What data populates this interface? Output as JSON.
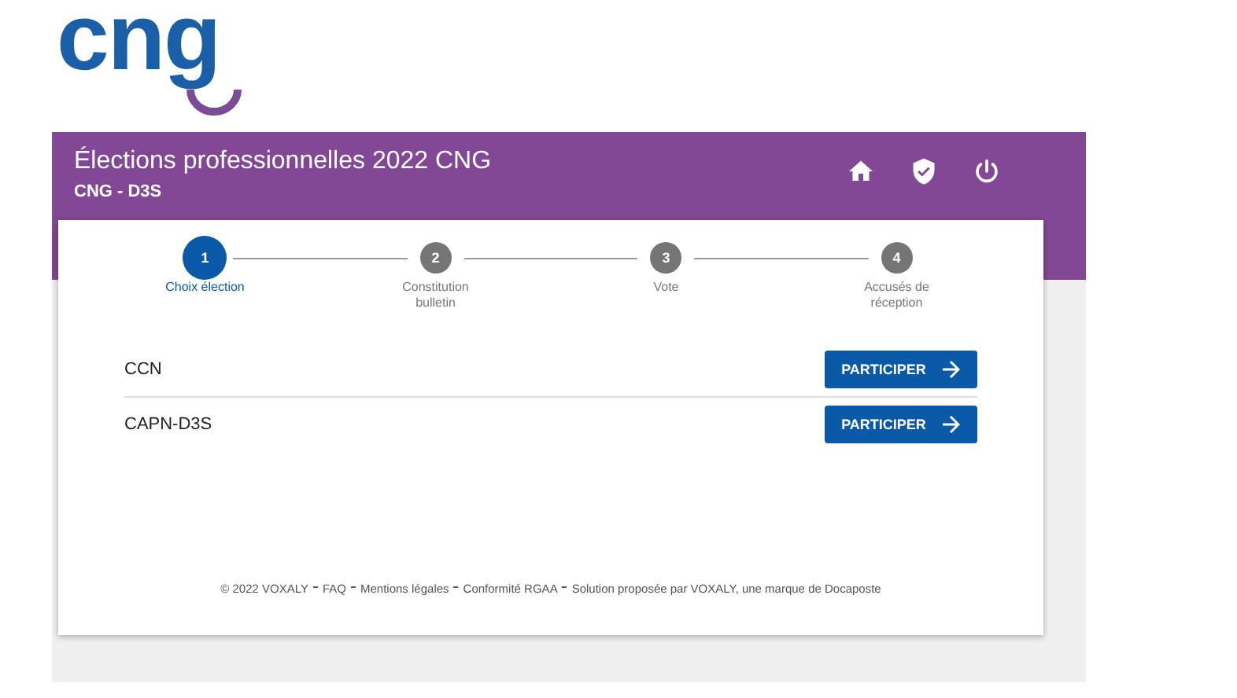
{
  "logo": {
    "text": "cng"
  },
  "header": {
    "title": "Élections professionnelles 2022 CNG",
    "subtitle": "CNG - D3S"
  },
  "toolbar": [
    {
      "kind": "home"
    },
    {
      "kind": "shield"
    },
    {
      "kind": "power"
    }
  ],
  "steps": [
    {
      "number": "1",
      "label": "Choix élection",
      "selected": true
    },
    {
      "number": "2",
      "label": "Constitution bulletin",
      "selected": false
    },
    {
      "number": "3",
      "label": "Vote",
      "selected": false
    },
    {
      "number": "4",
      "label": "Accusés de réception",
      "selected": false
    }
  ],
  "elections": [
    {
      "name": "CCN",
      "button": "PARTICIPER"
    },
    {
      "name": "CAPN-D3S",
      "button": "PARTICIPER"
    }
  ],
  "footer": [
    "© 2022 VOXALY",
    "FAQ",
    "Mentions légales",
    "Conformité RGAA",
    "Solution proposée par VOXALY, une marque de Docaposte"
  ]
}
